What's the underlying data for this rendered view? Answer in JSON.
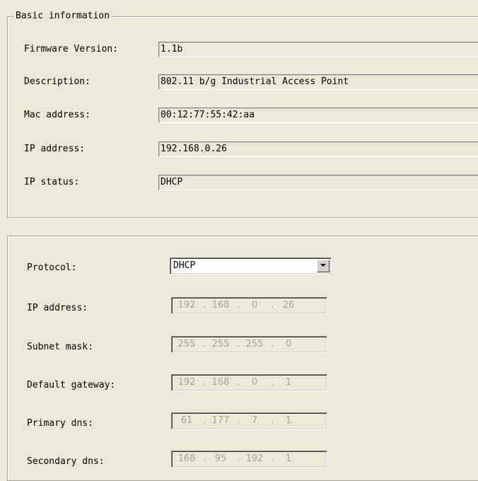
{
  "basic_info": {
    "title": "Basic information",
    "rows": [
      {
        "label": "Firmware Version:",
        "value": "1.1b"
      },
      {
        "label": "Description:",
        "value": "802.11 b/g Industrial Access Point"
      },
      {
        "label": "Mac address:",
        "value": "00:12:77:55:42:aa"
      },
      {
        "label": "IP address:",
        "value": "192.168.0.26"
      },
      {
        "label": "IP status:",
        "value": "DHCP"
      }
    ]
  },
  "network_settings": {
    "protocol": {
      "label": "Protocol:",
      "value": "DHCP"
    },
    "fields": [
      {
        "label": "IP address:",
        "octets": [
          "192",
          "168",
          "0",
          "26"
        ]
      },
      {
        "label": "Subnet mask:",
        "octets": [
          "255",
          "255",
          "255",
          "0"
        ]
      },
      {
        "label": "Default gateway:",
        "octets": [
          "192",
          "168",
          "0",
          "1"
        ]
      },
      {
        "label": "Primary dns:",
        "octets": [
          "61",
          "177",
          "7",
          "1"
        ]
      },
      {
        "label": "Secondary dns:",
        "octets": [
          "168",
          "95",
          "192",
          "1"
        ]
      }
    ]
  }
}
